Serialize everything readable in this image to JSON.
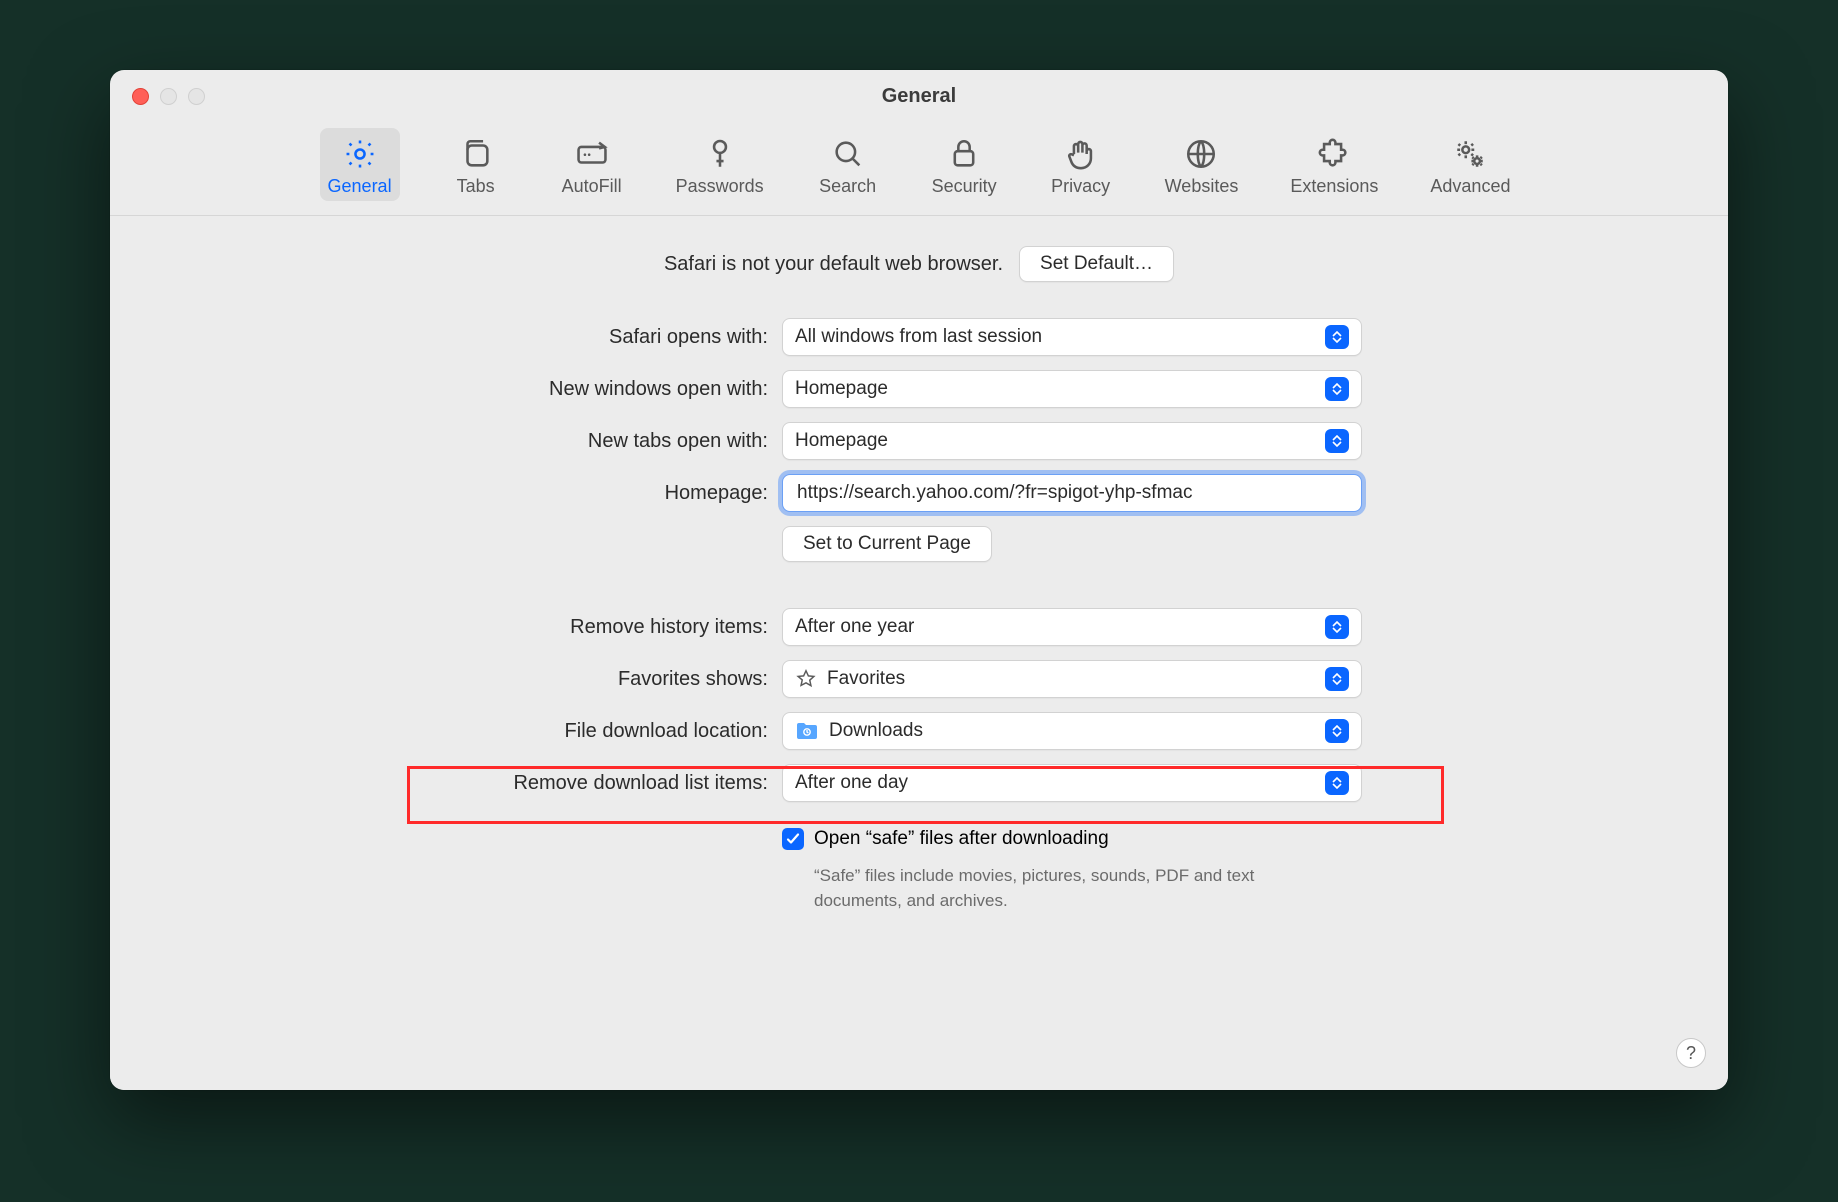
{
  "window": {
    "title": "General"
  },
  "toolbar": {
    "items": [
      {
        "label": "General"
      },
      {
        "label": "Tabs"
      },
      {
        "label": "AutoFill"
      },
      {
        "label": "Passwords"
      },
      {
        "label": "Search"
      },
      {
        "label": "Security"
      },
      {
        "label": "Privacy"
      },
      {
        "label": "Websites"
      },
      {
        "label": "Extensions"
      },
      {
        "label": "Advanced"
      }
    ]
  },
  "defaultBrowser": {
    "text": "Safari is not your default web browser.",
    "button": "Set Default…"
  },
  "form": {
    "opensWith": {
      "label": "Safari opens with:",
      "value": "All windows from last session"
    },
    "newWindows": {
      "label": "New windows open with:",
      "value": "Homepage"
    },
    "newTabs": {
      "label": "New tabs open with:",
      "value": "Homepage"
    },
    "homepage": {
      "label": "Homepage:",
      "value": "https://search.yahoo.com/?fr=spigot-yhp-sfmac"
    },
    "setCurrent": "Set to Current Page",
    "removeHistory": {
      "label": "Remove history items:",
      "value": "After one year"
    },
    "favorites": {
      "label": "Favorites shows:",
      "value": "Favorites"
    },
    "downloadLocation": {
      "label": "File download location:",
      "value": "Downloads"
    },
    "removeDownloads": {
      "label": "Remove download list items:",
      "value": "After one day"
    },
    "openSafe": {
      "label": "Open “safe” files after downloading",
      "checked": true
    },
    "safeHint": "“Safe” files include movies, pictures, sounds, PDF and text documents, and archives."
  },
  "help": "?"
}
